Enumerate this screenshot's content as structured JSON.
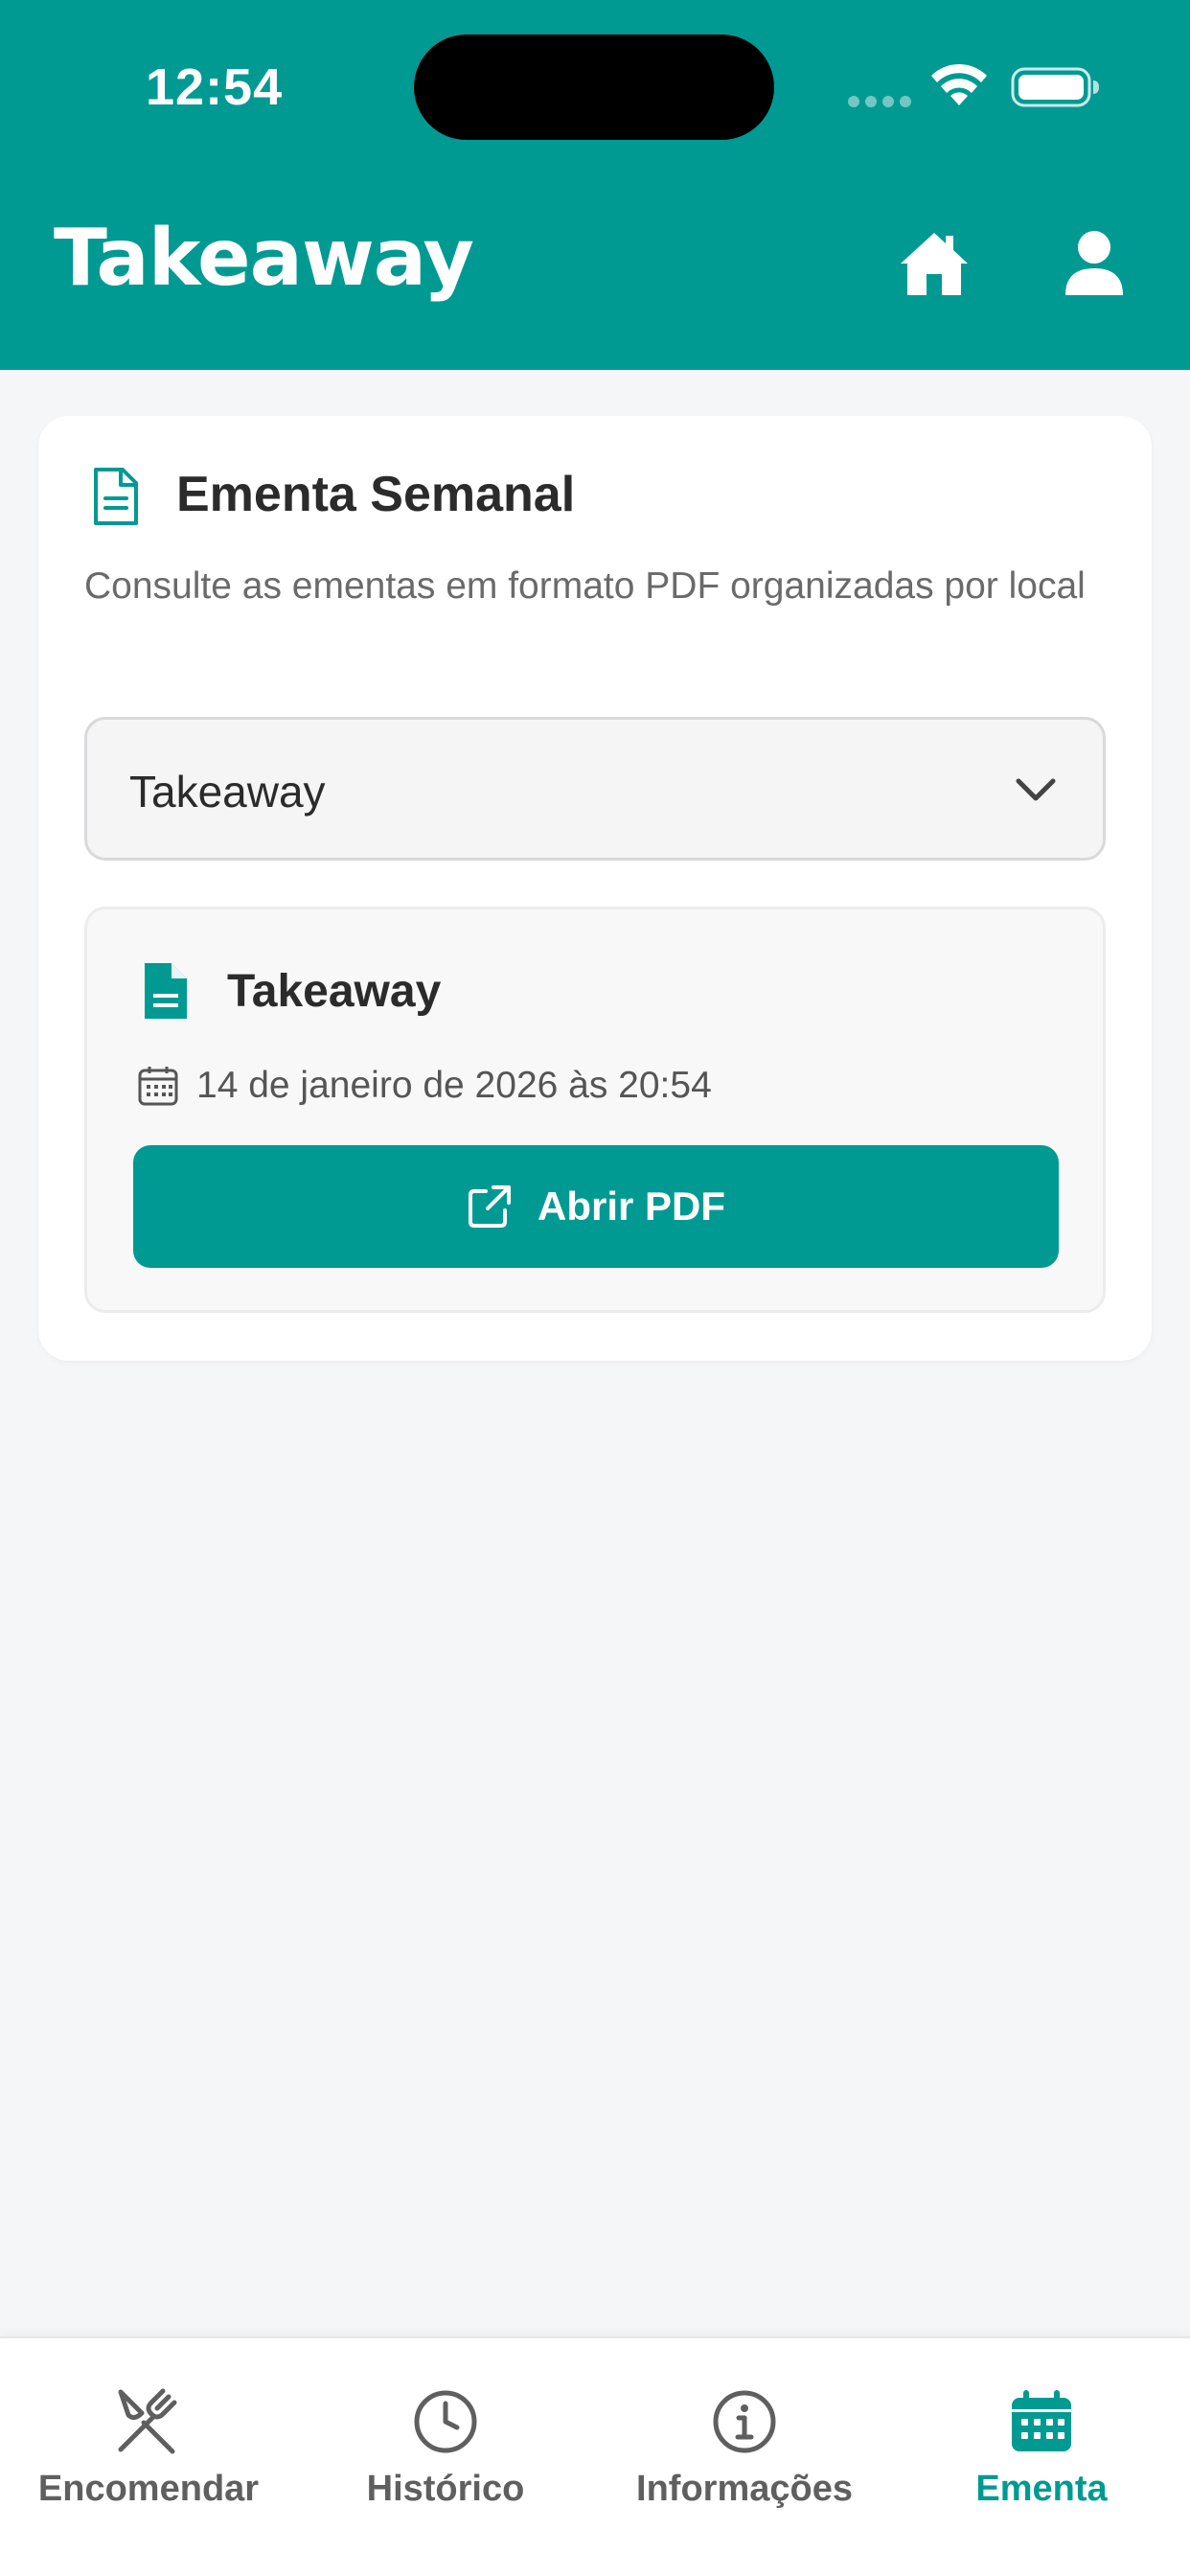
{
  "status_bar": {
    "time": "12:54"
  },
  "header": {
    "title": "Takeaway"
  },
  "card": {
    "title": "Ementa Semanal",
    "description": "Consulte as ementas em formato PDF organizadas por local",
    "select": {
      "selected_value": "Takeaway"
    },
    "pdf_item": {
      "name": "Takeaway",
      "date": "14 de janeiro de 2026 às 20:54",
      "button_label": "Abrir PDF"
    }
  },
  "bottom_nav": {
    "items": [
      {
        "label": "Encomendar",
        "icon": "utensils-crossed-icon",
        "active": false
      },
      {
        "label": "Histórico",
        "icon": "clock-icon",
        "active": false
      },
      {
        "label": "Informações",
        "icon": "info-icon",
        "active": false
      },
      {
        "label": "Ementa",
        "icon": "calendar-icon",
        "active": true
      }
    ]
  },
  "colors": {
    "brand": "#009a93",
    "background": "#f5f6f8",
    "text": "#2b2b2b",
    "muted_text": "#6a6a6a",
    "nav_inactive": "#5f5f5f"
  }
}
